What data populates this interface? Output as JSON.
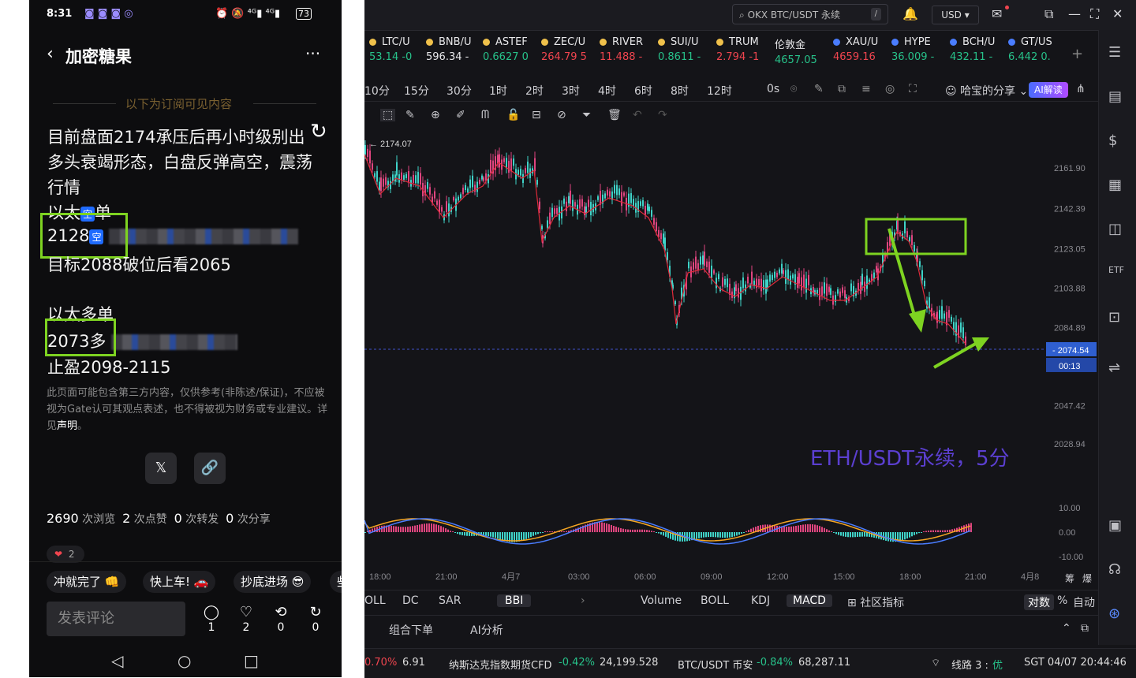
{
  "phone": {
    "status": {
      "time": "8:31",
      "battery": "73"
    },
    "header": {
      "title": "加密糖果",
      "more": "···"
    },
    "subscriber_divider": "以下为订阅可见内容",
    "post": {
      "line1": "目前盘面2174承压后再小时级别出",
      "line2": "多头衰竭形态，白盘反弹高空，震荡",
      "line3": "行情",
      "line4_pre": "以太",
      "line4_tag": "空",
      "line4_post": "单",
      "line5_price": "2128",
      "line5_tag": "空",
      "line6": "目标2088破位后看2065",
      "line7": "以太多单",
      "line8_price": "2073多",
      "line9": "止盈2098-2115"
    },
    "disclaimer_pre": "此页面可能包含第三方内容，仅供参考(非陈述/保证)，不应被视为Gate认可其观点表述，也不得被视为财务或专业建议。详见",
    "disclaimer_link": "声明",
    "disclaimer_end": "。",
    "share": {
      "x": "𝕏",
      "link": "🔗"
    },
    "stats": {
      "views": "2690",
      "views_label": "次浏览",
      "likes": "2",
      "likes_label": "次点赞",
      "reposts": "0",
      "reposts_label": "次转发",
      "shares": "0",
      "shares_label": "次分享"
    },
    "reaction_count": "2",
    "chips": [
      "冲就完了 👊",
      "快上车! 🚗",
      "抄底进场 😎",
      "些"
    ],
    "comment_placeholder": "发表评论",
    "actions": [
      {
        "icon": "◯",
        "count": "1"
      },
      {
        "icon": "♡",
        "count": "2"
      },
      {
        "icon": "⟲",
        "count": "0"
      },
      {
        "icon": "↻",
        "count": "0"
      }
    ],
    "nav": [
      "◁",
      "○",
      "□"
    ]
  },
  "app": {
    "search": "OKX BTC/USDT 永续",
    "search_shortcut": "/",
    "currency": "USD",
    "tickers": [
      {
        "name": "LTC/U",
        "price": "53.14 -0",
        "color": "#27c28a"
      },
      {
        "name": "BNB/U",
        "price": "596.34 -",
        "color": "#e8e8ea"
      },
      {
        "name": "ASTEF",
        "price": "0.6627 0",
        "color": "#27c28a"
      },
      {
        "name": "ZEC/U",
        "price": "264.79 5",
        "color": "#f0454f"
      },
      {
        "name": "RIVER",
        "price": "11.488 -",
        "color": "#f0454f"
      },
      {
        "name": "SUI/U",
        "price": "0.8611 -",
        "color": "#27c28a"
      },
      {
        "name": "TRUM",
        "price": "2.794 -1",
        "color": "#f0454f"
      },
      {
        "name": "伦敦金",
        "price": "4657.05",
        "color": "#27c28a"
      },
      {
        "name": "XAU/U",
        "price": "4659.16",
        "color": "#f0454f"
      },
      {
        "name": "HYPE",
        "price": "36.009 -",
        "color": "#27c28a"
      },
      {
        "name": "BCH/U",
        "price": "432.11 -",
        "color": "#27c28a"
      },
      {
        "name": "GT/US",
        "price": "6.442 0.",
        "color": "#27c28a"
      }
    ],
    "timeframes": [
      "10分",
      "15分",
      "30分",
      "1时",
      "2时",
      "3时",
      "4时",
      "6时",
      "8时",
      "12时",
      "0s"
    ],
    "share_label": "哈宝的分享",
    "ai_label": "AI解读",
    "chart_data": {
      "type": "candlestick",
      "title": "ETH/USDT永续，5分",
      "high_marker": "2174.07",
      "current_price": "2074.54",
      "countdown": "00:13",
      "y_ticks": [
        "2161.90",
        "2142.39",
        "2123.05",
        "2103.88",
        "2084.89",
        "2047.42",
        "2028.94"
      ],
      "x_ticks": [
        "18:00",
        "21:00",
        "4月7",
        "03:00",
        "06:00",
        "09:00",
        "12:00",
        "15:00",
        "18:00",
        "21:00",
        "4月8"
      ],
      "macd_ticks": [
        "10.00",
        "0.00",
        "-10.00"
      ]
    },
    "x_axis_extra": [
      "筹",
      "爆"
    ],
    "indicators_left": [
      "OLL",
      "DC",
      "SAR",
      "BBI"
    ],
    "indicators_right": [
      "Volume",
      "BOLL",
      "KDJ",
      "MACD",
      "社区指标"
    ],
    "scale_opts": [
      "对数",
      "%",
      "自动"
    ],
    "bottom_tabs": [
      "组合下单",
      "AI分析"
    ],
    "status_bar": {
      "item1_change": "0.70%",
      "item1_value": "6.91",
      "item2_name": "纳斯达克指数期货CFD",
      "item2_change": "-0.42%",
      "item2_value": "24,199.528",
      "item3_name": "BTC/USDT 币安",
      "item3_change": "-0.84%",
      "item3_value": "68,287.11",
      "line_label": "线路 3 :",
      "line_quality": "优",
      "clock": "SGT 04/07 20:44:46"
    }
  }
}
